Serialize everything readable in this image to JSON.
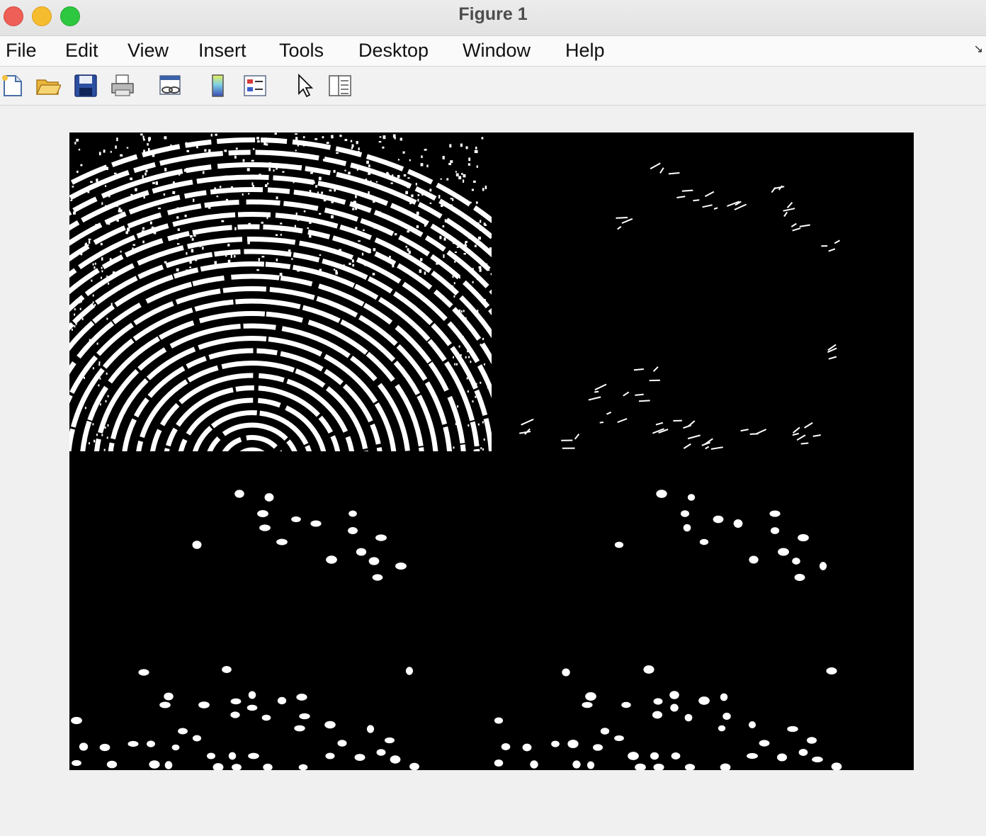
{
  "window": {
    "title": "Figure 1"
  },
  "menu": [
    "File",
    "Edit",
    "View",
    "Insert",
    "Tools",
    "Desktop",
    "Window",
    "Help"
  ],
  "toolbar": [
    {
      "icon": "new-figure-icon"
    },
    {
      "icon": "open-file-icon"
    },
    {
      "icon": "save-icon"
    },
    {
      "icon": "print-icon"
    },
    {
      "icon": "link-plot-icon"
    },
    {
      "icon": "colorbar-icon"
    },
    {
      "icon": "legend-icon"
    },
    {
      "icon": "pointer-icon"
    },
    {
      "icon": "property-inspector-icon"
    }
  ],
  "colors": {
    "figure_bg": "#f0f0f0",
    "image_bg": "#000000",
    "foreground": "#ffffff"
  },
  "images": [
    {
      "name": "binarized-fingerprint",
      "content": "dense white ridges on black"
    },
    {
      "name": "sparse-ridge-fragments",
      "content": "sparse white specks"
    },
    {
      "name": "detected-blobs-left",
      "content": "white dots"
    },
    {
      "name": "detected-blobs-right",
      "content": "white dots"
    }
  ]
}
